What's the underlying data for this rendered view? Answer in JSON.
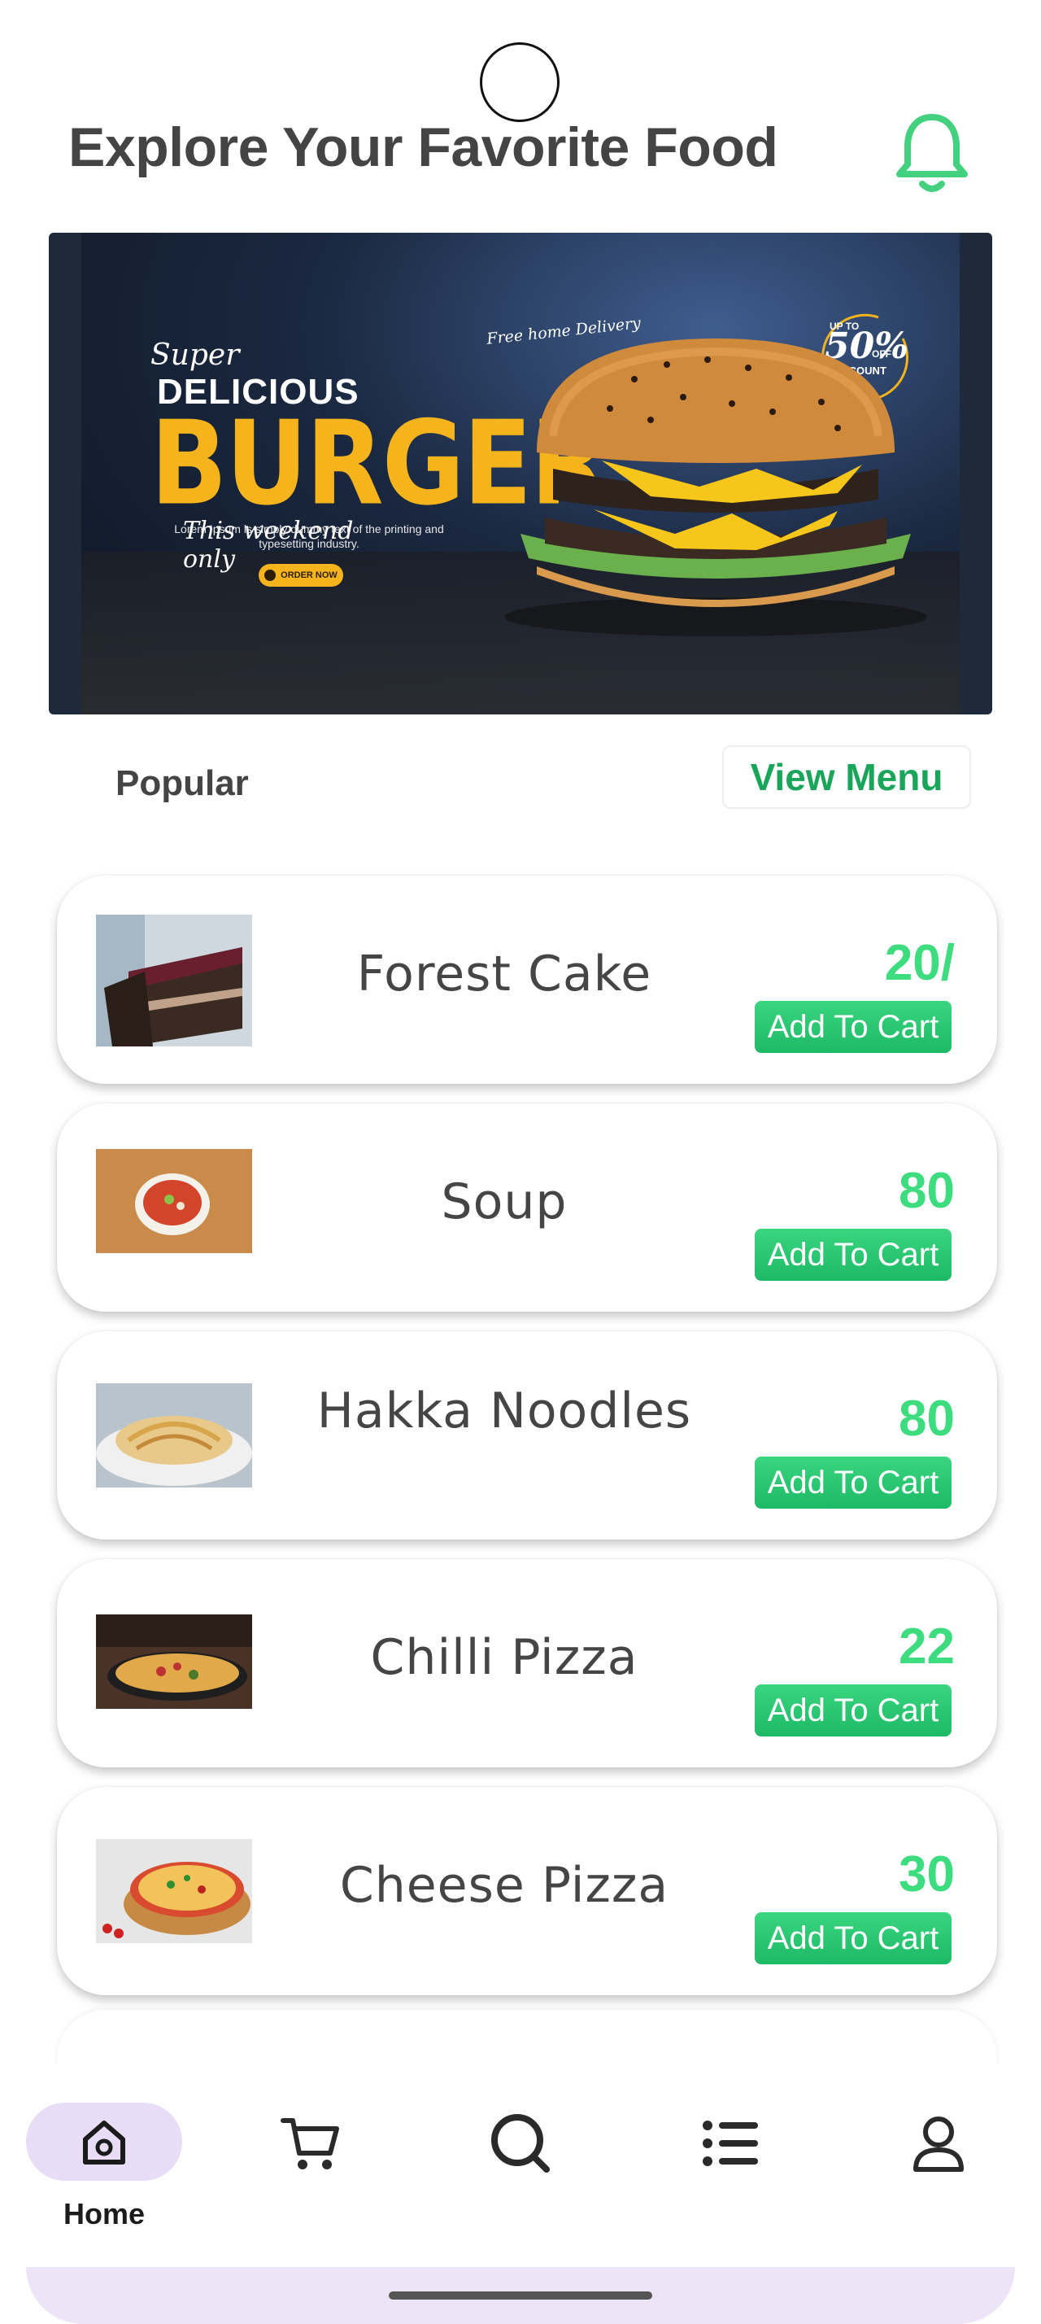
{
  "header": {
    "title": "Explore Your Favorite Food",
    "notification_icon": "bell-icon"
  },
  "banner": {
    "super": "Super",
    "delicious": "DELICIOUS",
    "burger": "BURGER",
    "weekend": "This weekend only",
    "lorem": "Lorem Ipsum is simply dummy text of the printing and typesetting industry.",
    "order_now": "ORDER NOW",
    "free_delivery": "Free home Delivery",
    "upto": "UP TO",
    "discount_pct": "50%",
    "off": "OFF",
    "discount_label": "DISCOUNT",
    "carousel_active_index": 2,
    "carousel_count": 3
  },
  "popular": {
    "label": "Popular",
    "view_menu": "View Menu"
  },
  "foods": [
    {
      "name": "Forest Cake",
      "price": "20/",
      "button": "Add To Cart"
    },
    {
      "name": "Soup",
      "price": "80",
      "button": "Add To Cart"
    },
    {
      "name": "Hakka Noodles",
      "price": "80",
      "button": "Add To Cart"
    },
    {
      "name": "Chilli Pizza",
      "price": "22",
      "button": "Add To Cart"
    },
    {
      "name": "Cheese Pizza",
      "price": "30",
      "button": "Add To Cart"
    }
  ],
  "nav": {
    "items": [
      {
        "icon": "home-icon",
        "label": "Home",
        "active": true
      },
      {
        "icon": "cart-icon"
      },
      {
        "icon": "search-icon"
      },
      {
        "icon": "list-icon"
      },
      {
        "icon": "profile-icon"
      }
    ]
  },
  "colors": {
    "accent_green": "#1aa65a",
    "price_green": "#3ddc7f",
    "burger_yellow": "#f5b41c",
    "nav_active_bg": "#e8dcf7"
  }
}
